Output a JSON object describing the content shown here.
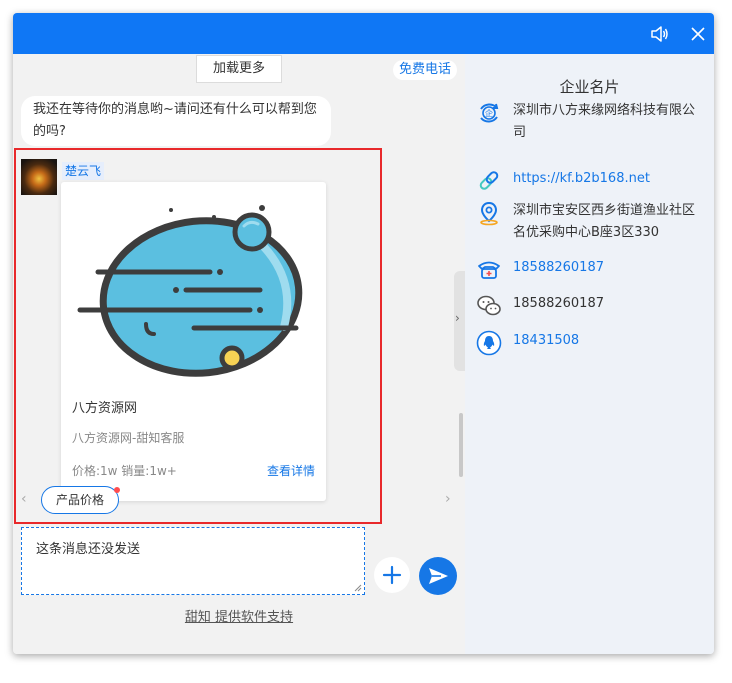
{
  "titlebar": {
    "icons": [
      "speaker-icon",
      "close-icon"
    ],
    "bg_color": "#0f77f5"
  },
  "chat": {
    "load_more": "加载更多",
    "free_call": "免费电话",
    "message": "我还在等待你的消息哟~请问还有什么可以帮到您的吗?",
    "sender_name": "楚云飞",
    "card": {
      "title": "八方资源网",
      "subtitle": "八方资源网-甜知客服",
      "meta": "价格:1w  销量:1w+",
      "detail_link": "查看详情"
    },
    "tab_label": "产品价格",
    "draft_text": "这条消息还没发送",
    "support_text": "甜知 提供软件支持"
  },
  "side": {
    "title": "企业名片",
    "company": "深圳市八方来缘网络科技有限公司",
    "website": "https://kf.b2b168.net",
    "address": "深圳市宝安区西乡街道渔业社区名优采购中心B座3区330",
    "phone": "18588260187",
    "wechat": "18588260187",
    "qq": "18431508"
  },
  "colors": {
    "accent": "#1677e6",
    "highlight_border": "#e8292b"
  }
}
